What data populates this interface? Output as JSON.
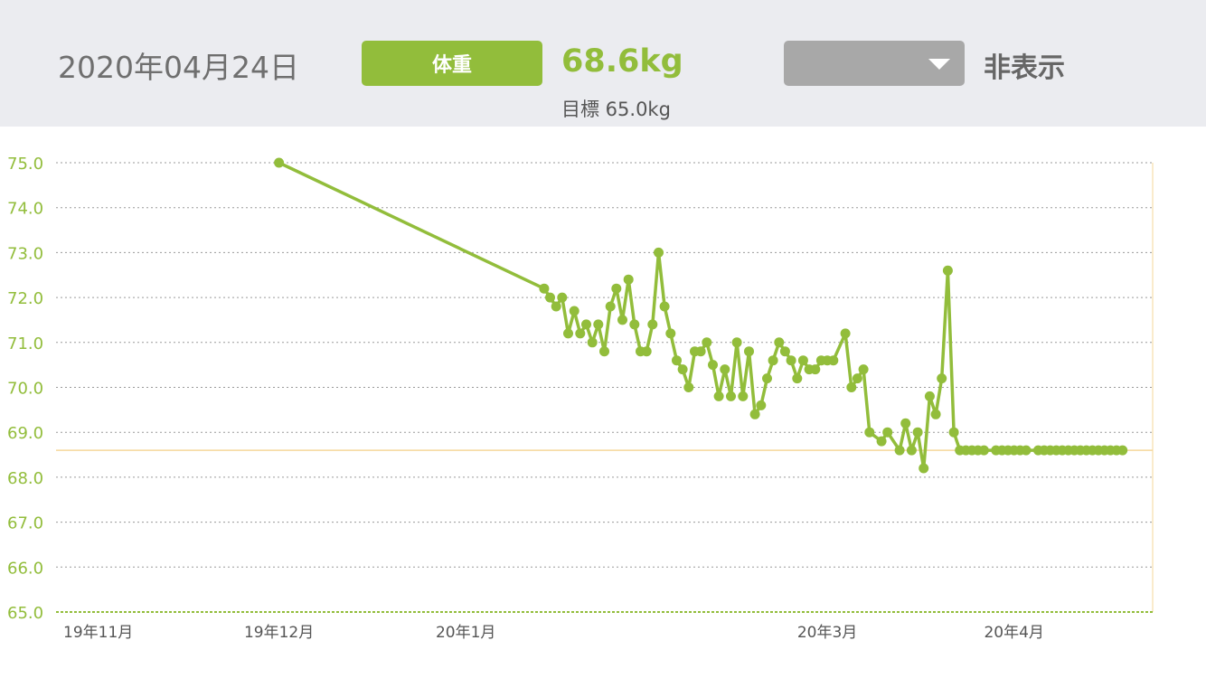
{
  "header": {
    "date": "2020年04月24日",
    "metric_button": "体重",
    "current_value": "68.6kg",
    "target_label": "目標 65.0kg",
    "dropdown_value": "",
    "hide_label": "非表示"
  },
  "colors": {
    "accent": "#92bd3b",
    "axis_text": "#92bd3b",
    "reference_line": "#f5d79a",
    "grid": "#9a9a9a",
    "header_bg": "#ebecf0",
    "dropdown": "#a8a8a8"
  },
  "chart_data": {
    "type": "line",
    "title": "",
    "xlabel": "",
    "ylabel": "",
    "ylim": [
      65.0,
      75.0
    ],
    "yticks": [
      "75.0",
      "74.0",
      "73.0",
      "72.0",
      "71.0",
      "70.0",
      "69.0",
      "68.0",
      "67.0",
      "66.0",
      "65.0"
    ],
    "xlim": [
      "2019-10-25",
      "2020-04-24"
    ],
    "xticks": [
      {
        "date": "2019-11-01",
        "label": "19年11月"
      },
      {
        "date": "2019-12-01",
        "label": "19年12月"
      },
      {
        "date": "2020-01-01",
        "label": "20年1月"
      },
      {
        "date": "2020-03-01",
        "label": "20年3月"
      },
      {
        "date": "2020-04-01",
        "label": "20年4月"
      }
    ],
    "reference_value": 68.6,
    "goal_value": 65.0,
    "grid": true,
    "series": [
      {
        "x": [
          "2019-12-01",
          "2020-01-14",
          "2020-01-15",
          "2020-01-16",
          "2020-01-17",
          "2020-01-18",
          "2020-01-19",
          "2020-01-20",
          "2020-01-21",
          "2020-01-22",
          "2020-01-23",
          "2020-01-24",
          "2020-01-25",
          "2020-01-26",
          "2020-01-27",
          "2020-01-28",
          "2020-01-29",
          "2020-01-30",
          "2020-01-31",
          "2020-02-01",
          "2020-02-02",
          "2020-02-03",
          "2020-02-04",
          "2020-02-05",
          "2020-02-06",
          "2020-02-07",
          "2020-02-08",
          "2020-02-09",
          "2020-02-10",
          "2020-02-11",
          "2020-02-12",
          "2020-02-13",
          "2020-02-14",
          "2020-02-15",
          "2020-02-16",
          "2020-02-17",
          "2020-02-18",
          "2020-02-19",
          "2020-02-20",
          "2020-02-21",
          "2020-02-22",
          "2020-02-23",
          "2020-02-24",
          "2020-02-25",
          "2020-02-26",
          "2020-02-27",
          "2020-02-28",
          "2020-02-29",
          "2020-03-01",
          "2020-03-02",
          "2020-03-04",
          "2020-03-05",
          "2020-03-06",
          "2020-03-07",
          "2020-03-08",
          "2020-03-10",
          "2020-03-11",
          "2020-03-13",
          "2020-03-14",
          "2020-03-15",
          "2020-03-16",
          "2020-03-17",
          "2020-03-18",
          "2020-03-19",
          "2020-03-20",
          "2020-03-21",
          "2020-03-22",
          "2020-03-23",
          "2020-03-24",
          "2020-03-25",
          "2020-03-26",
          "2020-03-27",
          "2020-03-29",
          "2020-03-30",
          "2020-03-31",
          "2020-04-01",
          "2020-04-02",
          "2020-04-03",
          "2020-04-05",
          "2020-04-06",
          "2020-04-07",
          "2020-04-08",
          "2020-04-09",
          "2020-04-10",
          "2020-04-11",
          "2020-04-12",
          "2020-04-13",
          "2020-04-14",
          "2020-04-15",
          "2020-04-16",
          "2020-04-17",
          "2020-04-18",
          "2020-04-19"
        ],
        "values": [
          75.0,
          72.2,
          72.0,
          71.8,
          72.0,
          71.2,
          71.7,
          71.2,
          71.4,
          71.0,
          71.4,
          70.8,
          71.8,
          72.2,
          71.5,
          72.4,
          71.4,
          70.8,
          70.8,
          71.4,
          73.0,
          71.8,
          71.2,
          70.6,
          70.4,
          70.0,
          70.8,
          70.8,
          71.0,
          70.5,
          69.8,
          70.4,
          69.8,
          71.0,
          69.8,
          70.8,
          69.4,
          69.6,
          70.2,
          70.6,
          71.0,
          70.8,
          70.6,
          70.2,
          70.6,
          70.4,
          70.4,
          70.6,
          70.6,
          70.6,
          71.2,
          70.0,
          70.2,
          70.4,
          69.0,
          68.8,
          69.0,
          68.6,
          69.2,
          68.6,
          69.0,
          68.2,
          69.8,
          69.4,
          70.2,
          72.6,
          69.0,
          68.6,
          68.6,
          68.6,
          68.6,
          68.6,
          68.6,
          68.6,
          68.6,
          68.6,
          68.6,
          68.6,
          68.6,
          68.6,
          68.6,
          68.6,
          68.6,
          68.6,
          68.6,
          68.6,
          68.6,
          68.6,
          68.6,
          68.6,
          68.6,
          68.6,
          68.6
        ]
      }
    ]
  }
}
